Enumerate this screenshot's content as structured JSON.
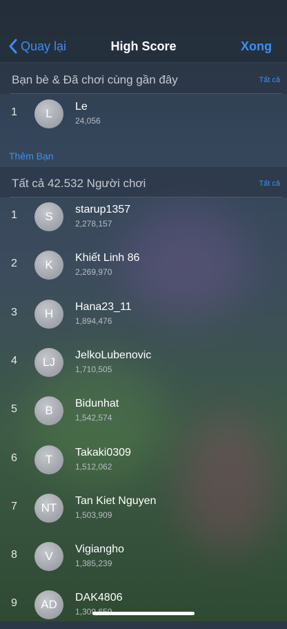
{
  "header": {
    "back_label": "Quay lại",
    "title": "High Score",
    "done_label": "Xong"
  },
  "friends_section": {
    "title": "Bạn bè & Đã chơi cùng gần đây",
    "all_label": "Tất cả"
  },
  "friends": [
    {
      "rank": "1",
      "initials": "L",
      "name": "Le",
      "score": "24,056"
    }
  ],
  "add_friend_label": "Thêm Bạn",
  "all_section": {
    "title": "Tất cả 42.532 Người chơi",
    "all_label": "Tất cả"
  },
  "players": [
    {
      "rank": "1",
      "initials": "S",
      "name": "starup1357",
      "score": "2,278,157"
    },
    {
      "rank": "2",
      "initials": "K",
      "name": "Khiết Linh 86",
      "score": "2,269,970"
    },
    {
      "rank": "3",
      "initials": "H",
      "name": "Hana23_11",
      "score": "1,894,476"
    },
    {
      "rank": "4",
      "initials": "LJ",
      "name": "JelkoLubenovic",
      "score": "1,710,505"
    },
    {
      "rank": "5",
      "initials": "B",
      "name": "Bidunhat",
      "score": "1,542,574"
    },
    {
      "rank": "6",
      "initials": "T",
      "name": "Takaki0309",
      "score": "1,512,062"
    },
    {
      "rank": "7",
      "initials": "NT",
      "name": "Tan Kiet Nguyen",
      "score": "1,503,909"
    },
    {
      "rank": "8",
      "initials": "V",
      "name": "Vigiangho",
      "score": "1,385,239"
    },
    {
      "rank": "9",
      "initials": "AD",
      "name": "DAK4806",
      "score": "1,309,659"
    }
  ]
}
